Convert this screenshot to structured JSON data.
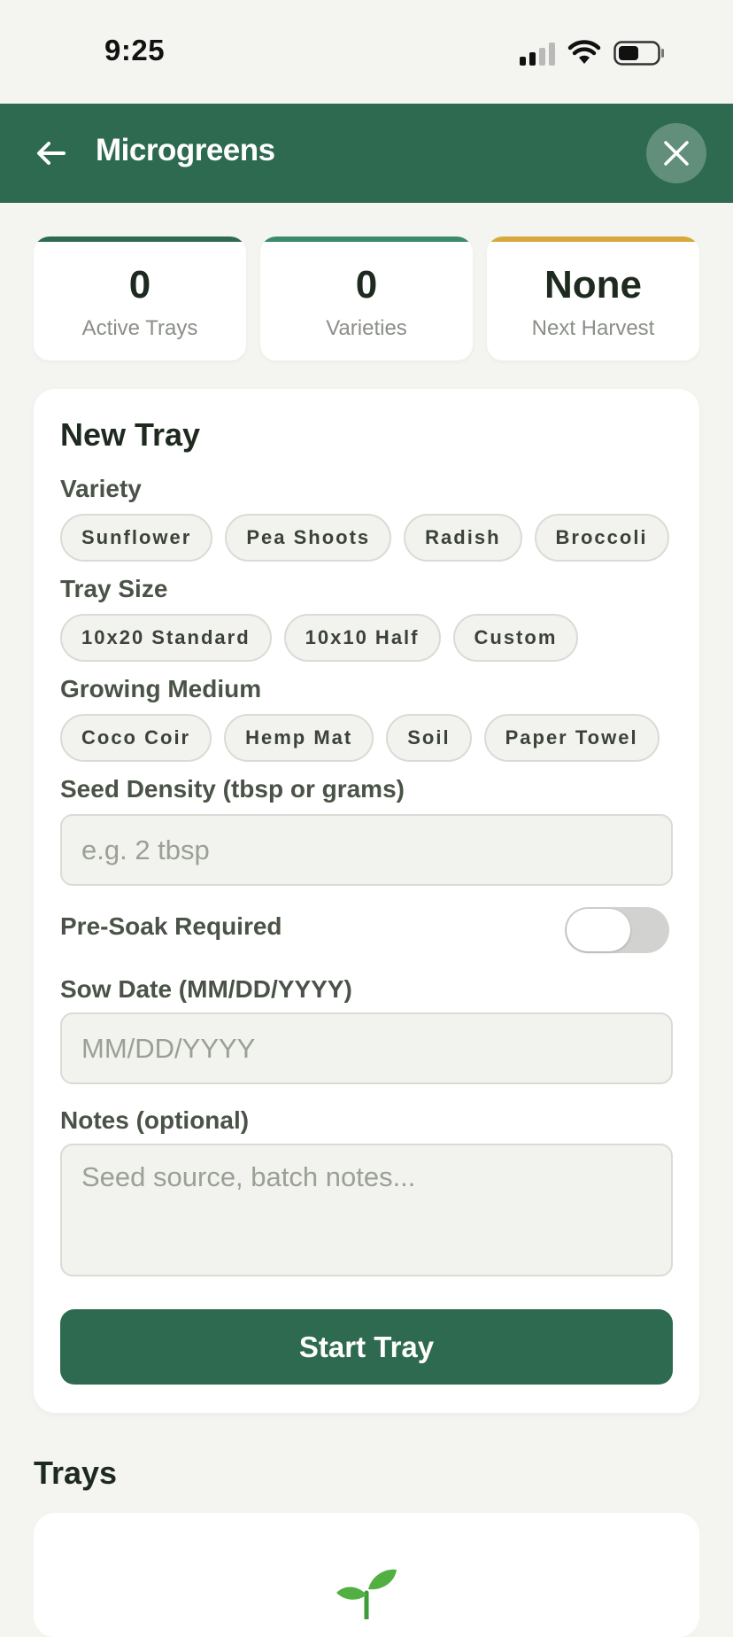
{
  "status_bar": {
    "time": "9:25"
  },
  "header": {
    "title": "Microgreens"
  },
  "stats": [
    {
      "value": "0",
      "label": "Active Trays",
      "accent": "#2d6a4f"
    },
    {
      "value": "0",
      "label": "Varieties",
      "accent": "#3b8a68"
    },
    {
      "value": "None",
      "label": "Next Harvest",
      "accent": "#d6a93a"
    }
  ],
  "form": {
    "title": "New Tray",
    "variety_label": "Variety",
    "varieties": [
      "Sunflower",
      "Pea Shoots",
      "Radish",
      "Broccoli"
    ],
    "tray_size_label": "Tray Size",
    "tray_sizes": [
      "10x20 Standard",
      "10x10 Half",
      "Custom"
    ],
    "medium_label": "Growing Medium",
    "mediums": [
      "Coco Coir",
      "Hemp Mat",
      "Soil",
      "Paper Towel"
    ],
    "density_label": "Seed Density (tbsp or grams)",
    "density_placeholder": "e.g. 2 tbsp",
    "presoak_label": "Pre-Soak Required",
    "presoak_on": false,
    "sow_date_label": "Sow Date (MM/DD/YYYY)",
    "sow_date_placeholder": "MM/DD/YYYY",
    "notes_label": "Notes (optional)",
    "notes_placeholder": "Seed source, batch notes...",
    "submit_label": "Start Tray"
  },
  "trays_section": {
    "title": "Trays"
  },
  "colors": {
    "primary": "#2d6a4f",
    "background": "#f4f5f1",
    "harvest_accent": "#d6a93a"
  }
}
